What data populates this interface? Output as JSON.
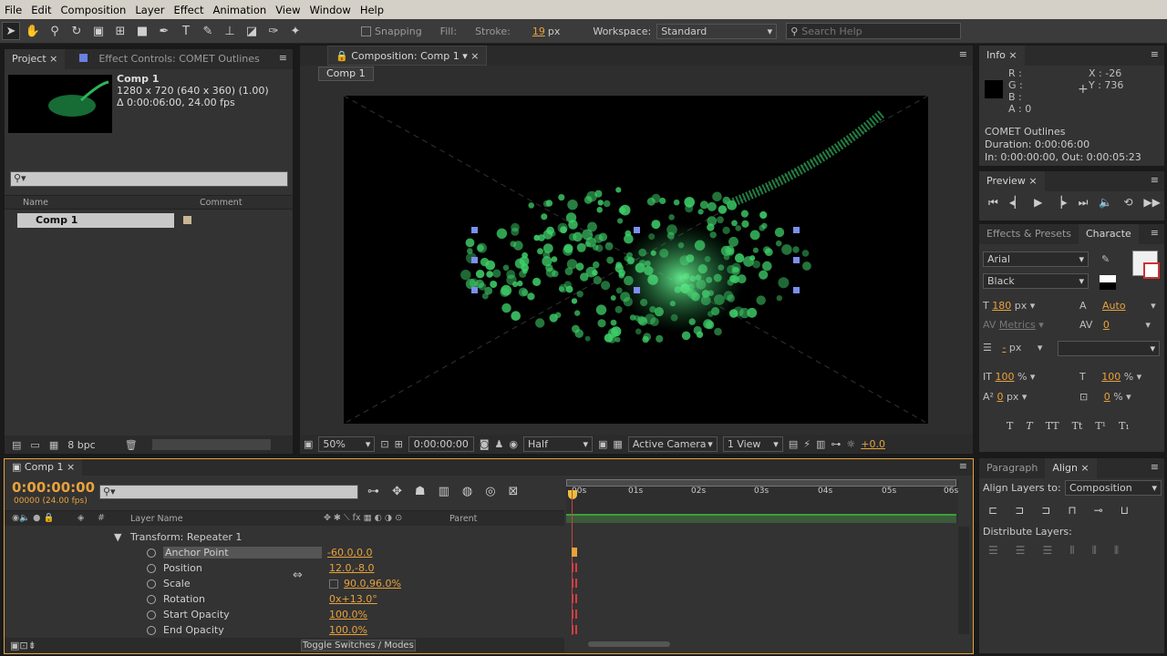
{
  "menu": [
    "File",
    "Edit",
    "Composition",
    "Layer",
    "Effect",
    "Animation",
    "View",
    "Window",
    "Help"
  ],
  "toolbar": {
    "snapping": "Snapping",
    "fill": "Fill:",
    "stroke": "Stroke:",
    "stroke_width": "19",
    "px": "px",
    "workspace_label": "Workspace:",
    "workspace": "Standard",
    "search_placeholder": "Search Help"
  },
  "project": {
    "tab": "Project",
    "effect_tab": "Effect Controls: COMET Outlines",
    "comp_name": "Comp 1",
    "comp_size": "1280 x 720  (640 x 360) (1.00)",
    "comp_duration": "Δ 0:00:06:00, 24.00 fps",
    "col_name": "Name",
    "col_comment": "Comment",
    "item": "Comp 1",
    "bpc": "8 bpc"
  },
  "composition": {
    "tab": "Composition: Comp 1",
    "crumb": "Comp 1",
    "zoom": "50%",
    "time": "0:00:00:00",
    "resolution": "Half",
    "camera": "Active Camera",
    "views": "1 View",
    "exposure": "+0.0"
  },
  "info": {
    "tab": "Info",
    "r": "R :",
    "g": "G :",
    "b": "B :",
    "a": "A : 0",
    "x": "X : -26",
    "y": "Y : 736",
    "layer": "COMET Outlines",
    "duration": "Duration: 0:00:06:00",
    "inout": "In: 0:00:00:00, Out: 0:00:05:23"
  },
  "preview": {
    "tab": "Preview"
  },
  "effects": {
    "tab": "Effects & Presets",
    "char_tab": "Characte"
  },
  "character": {
    "font": "Arial",
    "style": "Black",
    "size": "180",
    "size_unit": "px",
    "leading": "Auto",
    "kerning": "Metrics",
    "tracking": "0",
    "stroke_w": "-",
    "stroke_unit": "px",
    "vscale": "100",
    "vscale_unit": "%",
    "hscale": "100",
    "hscale_unit": "%",
    "baseline": "0",
    "baseline_unit": "px",
    "tsume": "0",
    "tsume_unit": "%",
    "styles": [
      "T",
      "T",
      "TT",
      "Tt",
      "T¹",
      "T₁"
    ]
  },
  "align": {
    "para_tab": "Paragraph",
    "tab": "Align",
    "align_to": "Align Layers to:",
    "target": "Composition",
    "distribute": "Distribute Layers:"
  },
  "timeline": {
    "tab": "Comp 1",
    "time": "0:00:00:00",
    "frames": "00000 (24.00 fps)",
    "col_layer": "Layer Name",
    "col_parent": "Parent",
    "hash": "#",
    "toggle": "Toggle Switches / Modes",
    "ticks": [
      "00s",
      "01s",
      "02s",
      "03s",
      "04s",
      "05s",
      "06s"
    ],
    "group": "Transform: Repeater 1",
    "props": [
      {
        "name": "Anchor Point",
        "value": "-60.0,0.0"
      },
      {
        "name": "Position",
        "value": "12.0,-8.0"
      },
      {
        "name": "Scale",
        "value": "90.0,96.0%"
      },
      {
        "name": "Rotation",
        "value": "0x+13.0°"
      },
      {
        "name": "Start Opacity",
        "value": "100.0%"
      },
      {
        "name": "End Opacity",
        "value": "100.0%"
      }
    ]
  },
  "colors": {
    "accent": "#e8a23c",
    "panel": "#333333",
    "particles": "#3fd06a"
  }
}
